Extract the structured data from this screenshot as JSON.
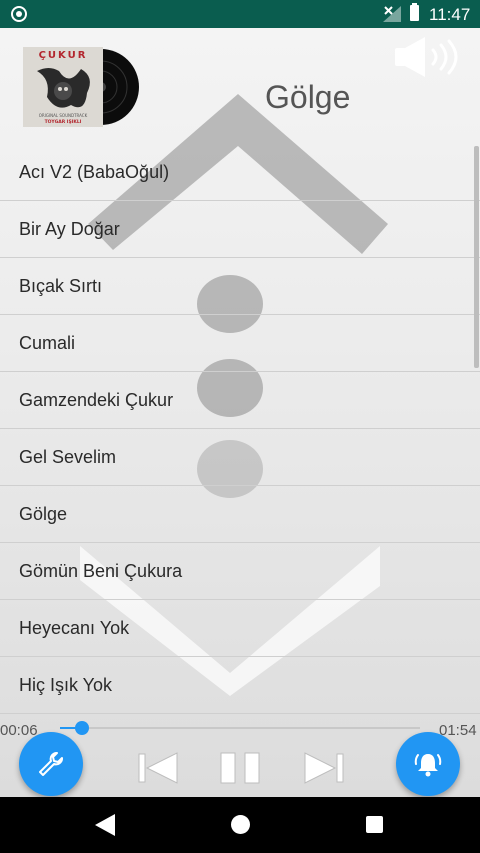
{
  "status_bar": {
    "time": "11:47"
  },
  "header": {
    "album_title": "ÇUKUR",
    "album_subtitle": "ORIGINAL SOUNDTRACK",
    "album_artist": "TOYGAR IŞIKLI",
    "current_song": "Gölge"
  },
  "songs": [
    "Acı V2 (BabaOğul)",
    "Bir Ay Doğar",
    "Bıçak Sırtı",
    "Cumali",
    "Gamzendeki Çukur",
    "Gel Sevelim",
    "Gölge",
    "Gömün Beni Çukura",
    "Heyecanı Yok",
    "Hiç Işık Yok"
  ],
  "player": {
    "elapsed": "00:06",
    "duration": "01:54",
    "progress": 0.06
  },
  "colors": {
    "status_bar": "#0a5d4f",
    "accent": "#2196f3"
  },
  "icons": {
    "volume": "volume-icon",
    "settings": "wrench-icon",
    "alarm": "alarm-icon",
    "previous": "skip-previous-icon",
    "pause": "pause-icon",
    "next": "skip-next-icon"
  }
}
